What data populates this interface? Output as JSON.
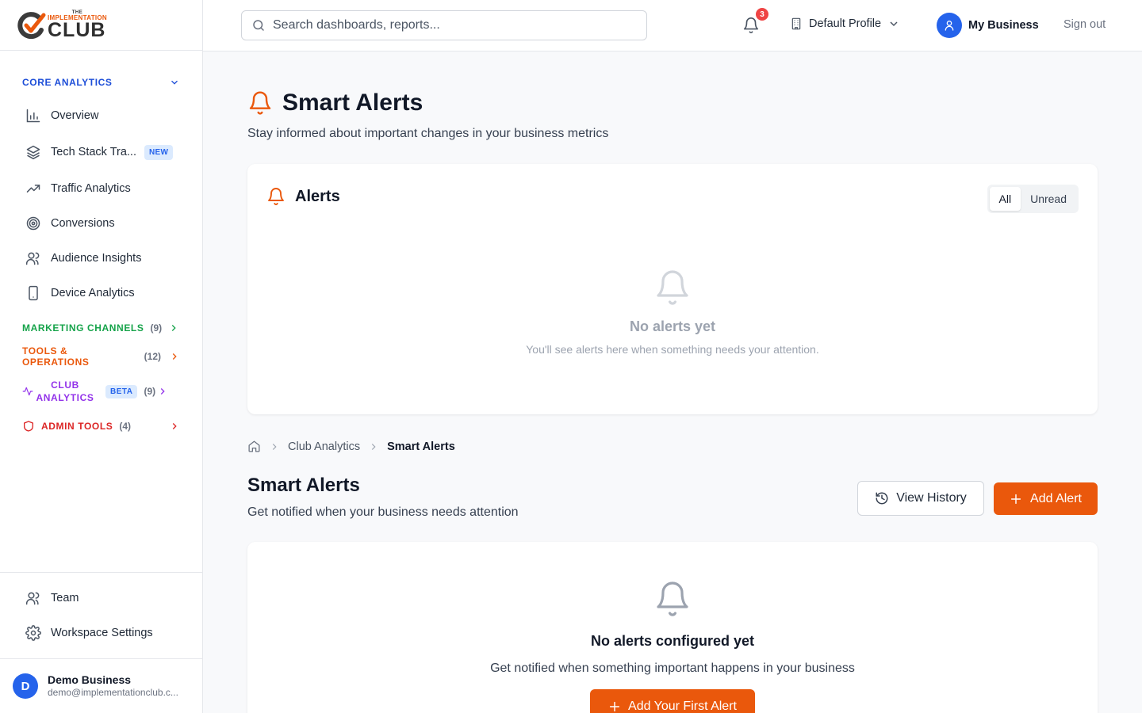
{
  "brand": {
    "the": "THE",
    "implementation": "IMPLEMENTATION",
    "club": "CLUB",
    "accent": "#ea580c"
  },
  "sidebar": {
    "core": {
      "label": "CORE ANALYTICS",
      "color": "#1d4ed8"
    },
    "items": [
      {
        "label": "Overview",
        "icon": "bar-chart-icon"
      },
      {
        "label": "Tech Stack Tra...",
        "icon": "layers-icon",
        "badge": "NEW"
      },
      {
        "label": "Traffic Analytics",
        "icon": "trending-up-icon"
      },
      {
        "label": "Conversions",
        "icon": "target-icon"
      },
      {
        "label": "Audience Insights",
        "icon": "users-icon"
      },
      {
        "label": "Device Analytics",
        "icon": "smartphone-icon"
      }
    ],
    "marketing": {
      "label": "MARKETING CHANNELS",
      "count": "(9)",
      "color": "#16a34a"
    },
    "tools": {
      "label": "TOOLS & OPERATIONS",
      "count": "(12)",
      "color": "#ea580c"
    },
    "club": {
      "label_line1": "CLUB",
      "label_line2": "ANALYTICS",
      "badge": "BETA",
      "count": "(9)",
      "color": "#9333ea"
    },
    "admin": {
      "label": "ADMIN TOOLS",
      "count": "(4)",
      "color": "#dc2626"
    },
    "bottom": [
      {
        "label": "Team",
        "icon": "users-icon"
      },
      {
        "label": "Workspace Settings",
        "icon": "gear-icon"
      }
    ],
    "user": {
      "initial": "D",
      "name": "Demo Business",
      "email": "demo@implementationclub.c..."
    }
  },
  "topbar": {
    "search_placeholder": "Search dashboards, reports...",
    "notifications": "3",
    "profile": "Default Profile",
    "account": "My Business",
    "signout": "Sign out"
  },
  "main": {
    "title": "Smart Alerts",
    "subtitle": "Stay informed about important changes in your business metrics",
    "alerts_card": {
      "title": "Alerts",
      "filters": [
        "All",
        "Unread"
      ],
      "active_filter": "All",
      "empty_title": "No alerts yet",
      "empty_text": "You'll see alerts here when something needs your attention."
    },
    "breadcrumb": [
      "Club Analytics",
      "Smart Alerts"
    ],
    "section": {
      "title": "Smart Alerts",
      "subtitle": "Get notified when your business needs attention",
      "history_button": "View History",
      "add_button": "Add Alert"
    },
    "config_card": {
      "empty_title": "No alerts configured yet",
      "empty_text": "Get notified when something important happens in your business",
      "button": "Add Your First Alert"
    }
  }
}
